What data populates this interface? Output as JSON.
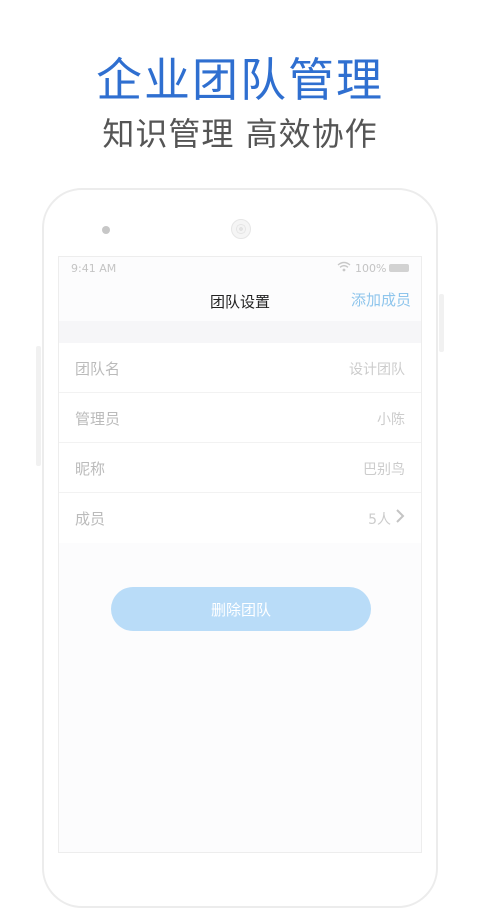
{
  "promo": {
    "title": "企业团队管理",
    "subtitle": "知识管理 高效协作"
  },
  "status_bar": {
    "time": "9:41 AM",
    "battery": "100%"
  },
  "nav": {
    "title": "团队设置",
    "action": "添加成员"
  },
  "settings": [
    {
      "label": "团队名",
      "value": "设计团队"
    },
    {
      "label": "管理员",
      "value": "小陈"
    },
    {
      "label": "昵称",
      "value": "巴别鸟"
    },
    {
      "label": "成员",
      "value": "5人"
    }
  ],
  "delete_label": "删除团队",
  "colors": {
    "accent": "#2f6fd0",
    "link": "#8ec5ec",
    "button": "#b9dcf8"
  }
}
